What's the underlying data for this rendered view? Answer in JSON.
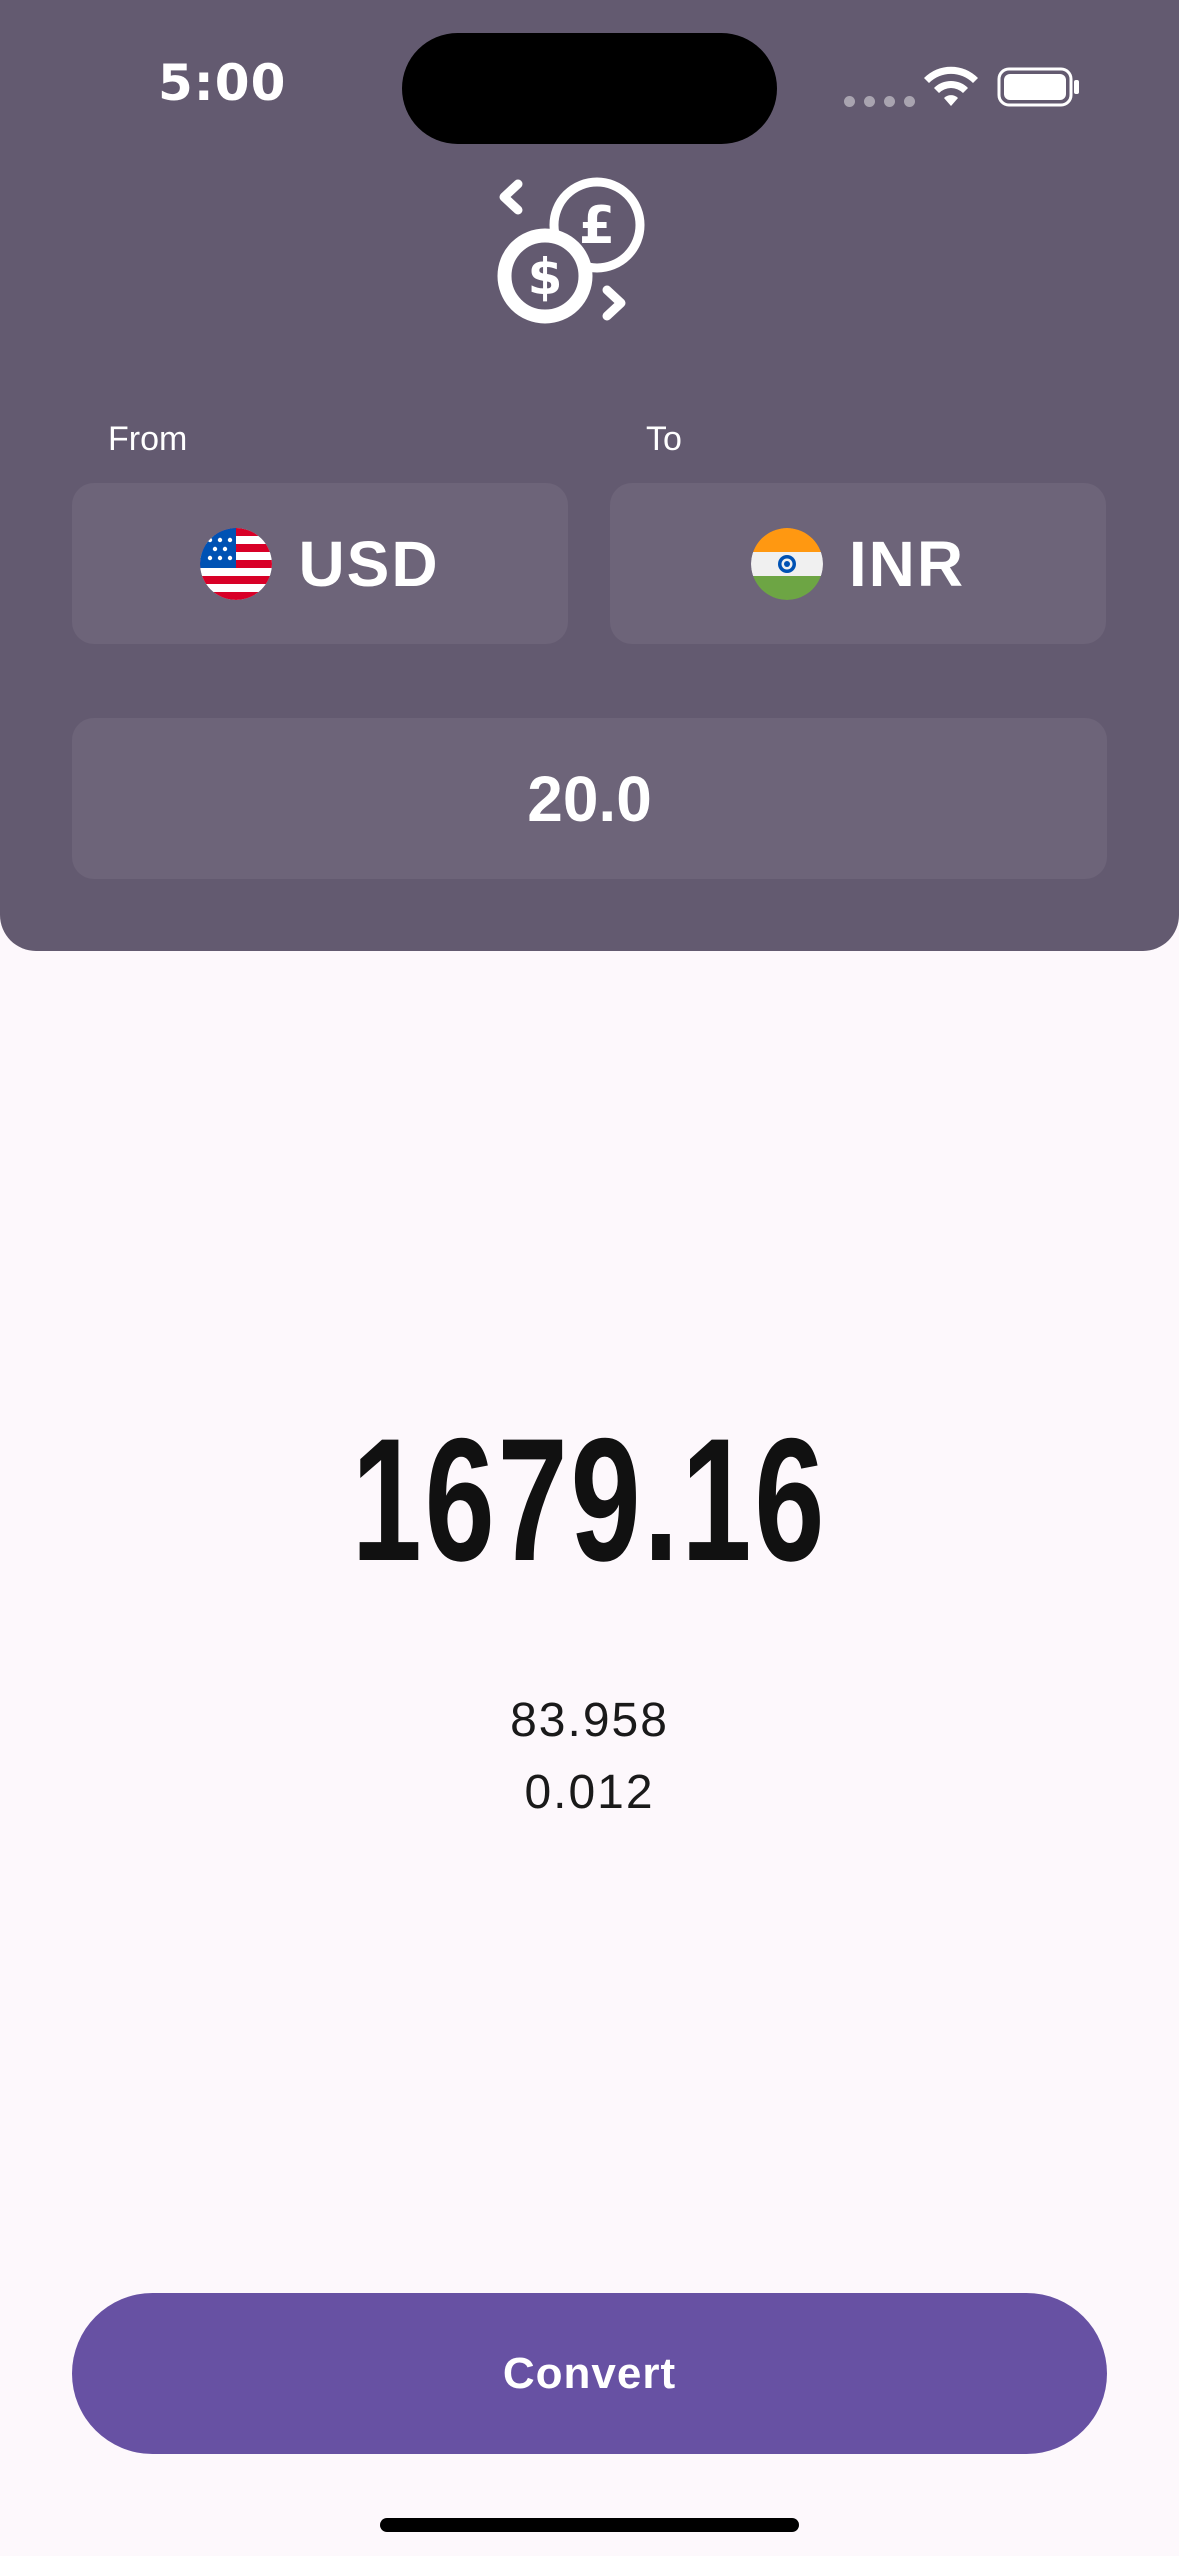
{
  "status_bar": {
    "time": "5:00",
    "icons": [
      "cellular-dots-icon",
      "wifi-icon",
      "battery-icon"
    ]
  },
  "header": {
    "logo_icon": "currency-exchange-icon"
  },
  "converter": {
    "from_label": "From",
    "to_label": "To",
    "from_currency": {
      "code": "USD",
      "flag_icon": "us-flag-icon"
    },
    "to_currency": {
      "code": "INR",
      "flag_icon": "india-flag-icon"
    },
    "amount_value": "20.0"
  },
  "result": {
    "converted_amount": "1679.16",
    "rate_forward": "83.958",
    "rate_reverse": "0.012"
  },
  "actions": {
    "convert_label": "Convert"
  },
  "colors": {
    "panel_background": "#635a70",
    "field_background": "#6d6479",
    "button_background": "#6751a3",
    "page_background": "#fdf8fc"
  }
}
